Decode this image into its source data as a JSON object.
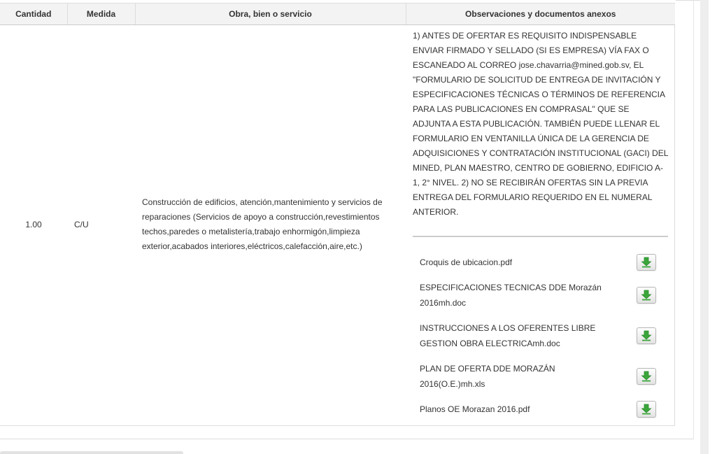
{
  "table": {
    "headers": {
      "quantity": "Cantidad",
      "unit": "Medida",
      "item": "Obra, bien o servicio",
      "observations": "Observaciones y documentos anexos"
    },
    "row": {
      "quantity": "1.00",
      "unit": "C/U",
      "description": "Construcción de edificios, atención,mantenimiento y servicios de reparaciones (Servicios de apoyo a construcción,revestimientos techos,paredes o metalistería,trabajo enhormigón,limpieza exterior,acabados interiores,eléctricos,calefacción,aire,etc.)",
      "observations": "1) ANTES DE OFERTAR ES REQUISITO INDISPENSABLE ENVIAR FIRMADO Y SELLADO (SI ES EMPRESA) VÍA FAX O ESCANEADO AL CORREO jose.chavarria@mined.gob.sv, EL \"FORMULARIO DE SOLICITUD DE ENTREGA DE INVITACIÓN Y ESPECIFICACIONES TÉCNICAS O TÉRMINOS DE REFERENCIA PARA LAS PUBLICACIONES EN COMPRASAL\" QUE SE ADJUNTA A ESTA PUBLICACIÓN. TAMBIÉN PUEDE LLENAR EL FORMULARIO EN VENTANILLA ÚNICA DE LA GERENCIA DE ADQUISICIONES Y CONTRATACIÓN INSTITUCIONAL (GACI) DEL MINED, PLAN MAESTRO, CENTRO DE GOBIERNO, EDIFICIO A-1, 2° NIVEL. 2) NO SE RECIBIRÁN OFERTAS SIN LA PREVIA ENTREGA DEL FORMULARIO REQUERIDO EN EL NUMERAL ANTERIOR.",
      "files": [
        {
          "name": "Croquis de ubicacion.pdf",
          "icon": "download-icon"
        },
        {
          "name": "ESPECIFICACIONES TECNICAS DDE Morazán 2016mh.doc",
          "icon": "download-icon"
        },
        {
          "name": "INSTRUCCIONES A LOS OFERENTES LIBRE GESTION OBRA ELECTRICAmh.doc",
          "icon": "download-icon"
        },
        {
          "name": "PLAN DE OFERTA DDE MORAZÁN 2016(O.E.)mh.xls",
          "icon": "download-icon"
        },
        {
          "name": "Planos OE Morazan 2016.pdf",
          "icon": "download-icon"
        }
      ]
    }
  },
  "colors": {
    "header_bg": "#f3f3f3",
    "border": "#dddddd",
    "text": "#333333",
    "download_arrow": "#3aa63a"
  }
}
